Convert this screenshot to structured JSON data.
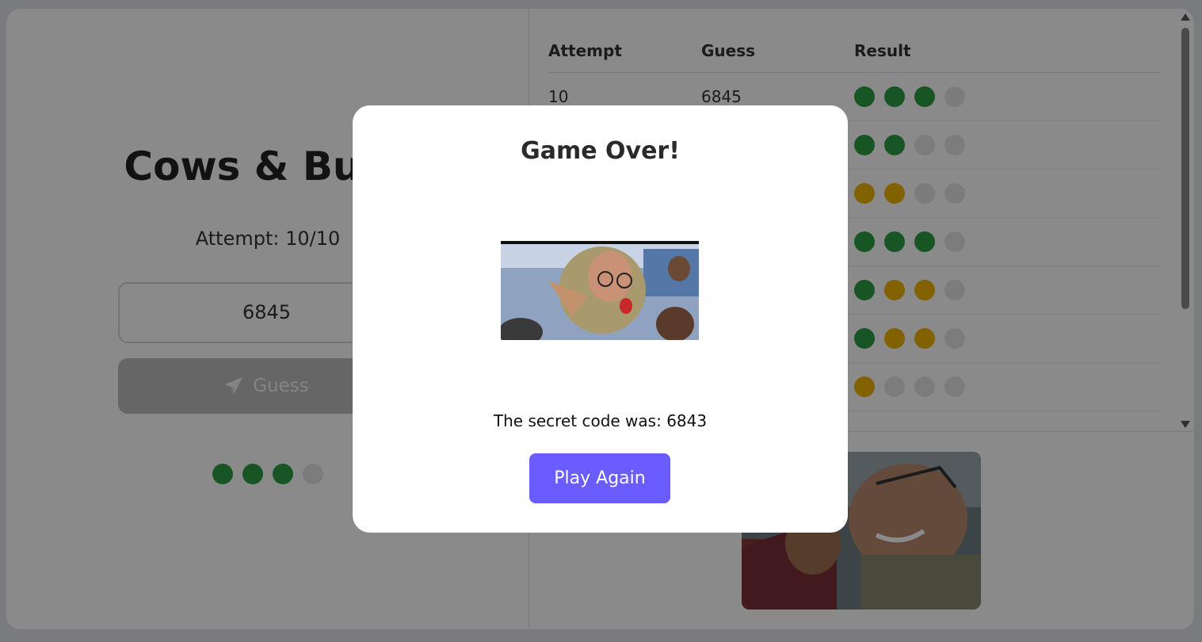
{
  "game": {
    "title": "Cows & Bulls",
    "attempt_text": "Attempt: 10/10",
    "input_value": "6845",
    "guess_button_label": "Guess",
    "current_result": [
      "bull",
      "bull",
      "bull",
      "empty"
    ]
  },
  "colors": {
    "bull": "#2e9e44",
    "cow": "#f0b400",
    "empty": "#e6e6e6",
    "accent": "#6a5cff"
  },
  "history": {
    "headers": [
      "Attempt",
      "Guess",
      "Result"
    ],
    "rows": [
      {
        "attempt": "10",
        "guess": "6845",
        "result": [
          "bull",
          "bull",
          "bull",
          "empty"
        ]
      },
      {
        "attempt": "",
        "guess": "",
        "result": [
          "bull",
          "bull",
          "empty",
          "empty"
        ]
      },
      {
        "attempt": "",
        "guess": "",
        "result": [
          "cow",
          "cow",
          "empty",
          "empty"
        ]
      },
      {
        "attempt": "",
        "guess": "",
        "result": [
          "bull",
          "bull",
          "bull",
          "empty"
        ]
      },
      {
        "attempt": "",
        "guess": "",
        "result": [
          "bull",
          "cow",
          "cow",
          "empty"
        ]
      },
      {
        "attempt": "",
        "guess": "",
        "result": [
          "bull",
          "cow",
          "cow",
          "empty"
        ]
      },
      {
        "attempt": "",
        "guess": "",
        "result": [
          "cow",
          "empty",
          "empty",
          "empty"
        ]
      }
    ]
  },
  "modal": {
    "title": "Game Over!",
    "secret_text": "The secret code was: 6843",
    "play_again_label": "Play Again"
  },
  "icons": {
    "guess_button_icon": "paper-plane-icon"
  }
}
